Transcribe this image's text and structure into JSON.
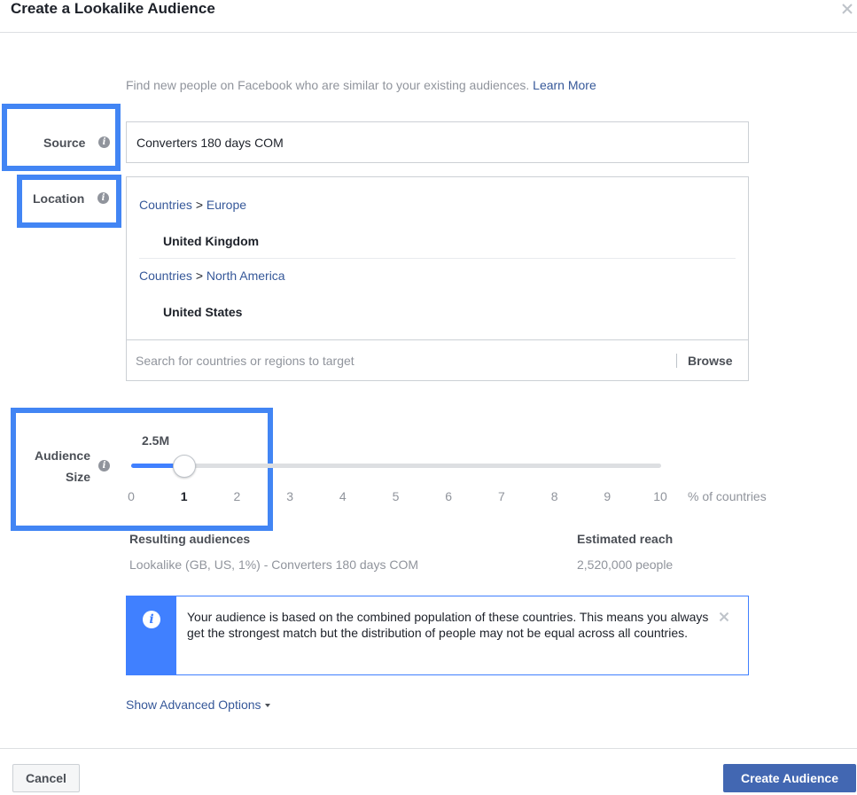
{
  "dialog": {
    "title": "Create a Lookalike Audience",
    "close_icon": "close-icon"
  },
  "intro": {
    "text": "Find new people on Facebook who are similar to your existing audiences.",
    "learn_more": "Learn More"
  },
  "source": {
    "label": "Source",
    "value": "Converters 180 days COM"
  },
  "location": {
    "label": "Location",
    "groups": [
      {
        "root": "Countries",
        "separator": ">",
        "region": "Europe",
        "country": "United Kingdom"
      },
      {
        "root": "Countries",
        "separator": ">",
        "region": "North America",
        "country": "United States"
      }
    ],
    "search_placeholder": "Search for countries or regions to target",
    "browse_label": "Browse"
  },
  "audience_size": {
    "label_line1": "Audience",
    "label_line2": "Size",
    "current_value_label": "2.5M",
    "selected_percent": 1,
    "min": 0,
    "max": 10,
    "ticks": [
      "0",
      "1",
      "2",
      "3",
      "4",
      "5",
      "6",
      "7",
      "8",
      "9",
      "10"
    ],
    "unit": "% of countries"
  },
  "results": {
    "audiences_header": "Resulting audiences",
    "audiences_value": "Lookalike (GB, US, 1%) - Converters 180 days COM",
    "reach_header": "Estimated reach",
    "reach_value": "2,520,000 people"
  },
  "notice": {
    "icon": "info-icon",
    "text": "Your audience is based on the combined population of these countries. This means you always get the strongest match but the distribution of people may not be equal across all countries."
  },
  "advanced": {
    "label": "Show Advanced Options"
  },
  "footer": {
    "cancel": "Cancel",
    "create": "Create Audience"
  },
  "colors": {
    "link": "#365899",
    "primary_button": "#4267b2",
    "slider_fill": "#4080ff",
    "highlight_annotation": "#4285f4"
  }
}
